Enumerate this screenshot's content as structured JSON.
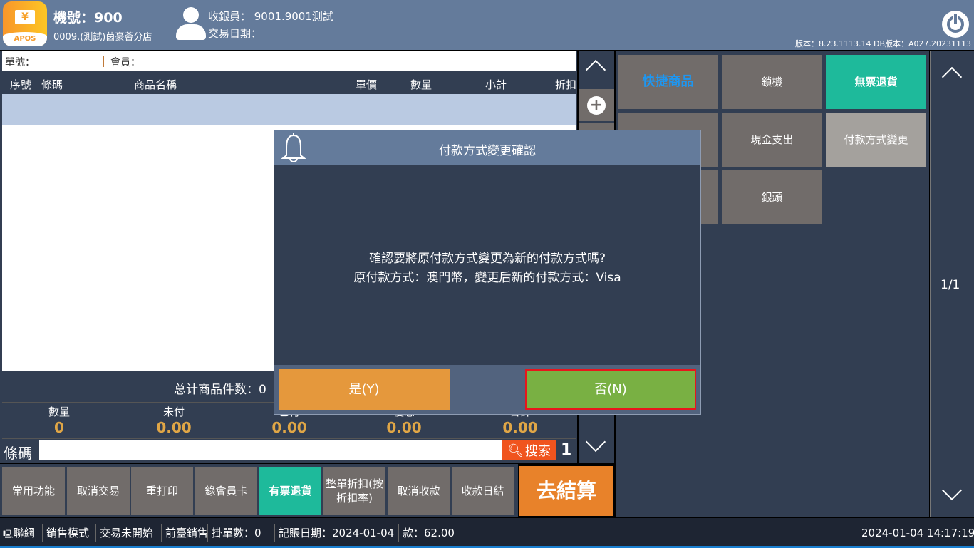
{
  "header": {
    "logo_text": "APOS",
    "machine": "機號：900",
    "store": "0009.(測試)茵豪薈分店",
    "cashier": "收銀員：  9001.9001測試",
    "trans_date": "交易日期：",
    "version": "版本：8.23.1113.14 DB版本：A027.20231113"
  },
  "info": {
    "order_no": "單號：",
    "member": "會員："
  },
  "table": {
    "columns": [
      "序號",
      "條碼",
      "商品名稱",
      "單價",
      "數量",
      "小計",
      "折扣"
    ]
  },
  "summary": {
    "total_items": "总计商品件数：0",
    "fields": [
      {
        "label": "數量",
        "value": "0"
      },
      {
        "label": "未付",
        "value": "0.00"
      },
      {
        "label": "已付",
        "value": "0.00"
      },
      {
        "label": "優惠",
        "value": "0.00"
      },
      {
        "label": "合計",
        "value": "0.00"
      }
    ]
  },
  "barcode": {
    "label": "條碼",
    "value": "",
    "search": "搜索",
    "qty": "1"
  },
  "bottom_buttons": [
    "常用功能",
    "取消交易",
    "重打印",
    "錄會員卡",
    "有票退貨",
    "整單折扣(按折扣率)",
    "取消收款",
    "收款日結"
  ],
  "checkout": "去結算",
  "quick": {
    "tiles": [
      "快捷商品",
      "鎖機",
      "無票退貨",
      "",
      "現金支出",
      "付款方式變更",
      "",
      "銀頭"
    ],
    "page": "1/1"
  },
  "dialog": {
    "title": "付款方式變更確認",
    "line1": "確認要將原付款方式變更為新的付款方式嗎?",
    "line2": "原付款方式：澳門幣，變更后新的付款方式：Visa",
    "yes": "是(Y)",
    "no": "否(N)"
  },
  "status": {
    "items": [
      "聯網",
      "銷售模式",
      "交易未開始",
      "前臺銷售",
      "掛單數：0",
      "記賬日期：2024-01-04",
      "款：62.00"
    ],
    "datetime": "2024-01-04 14:17:19"
  },
  "colors": {
    "header": "#647b9b",
    "panel": "#323e52",
    "tile": "#716c6a",
    "green": "#1eba9b",
    "orange": "#e8822a",
    "yes": "#e5983c",
    "no": "#79b043"
  }
}
